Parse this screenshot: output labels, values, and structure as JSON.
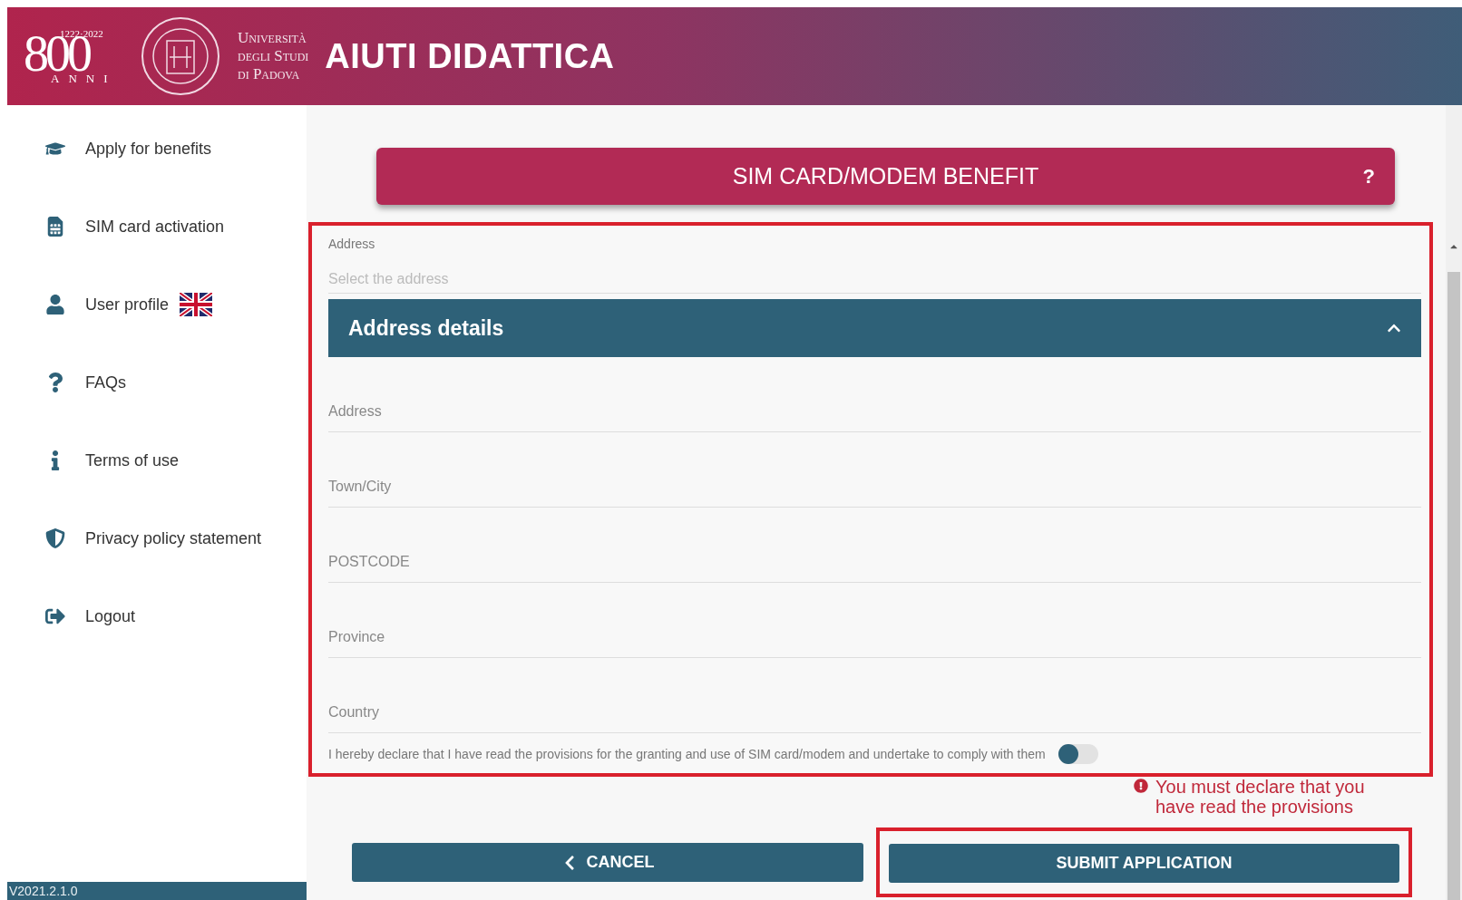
{
  "header": {
    "logo_years": "1222·2022",
    "logo_number": "800",
    "logo_word": "ANNI",
    "university_lines": [
      "Università",
      "degli Studi",
      "di Padova"
    ],
    "title": "AIUTI DIDATTICA"
  },
  "sidebar": {
    "items": [
      {
        "label": "Apply for benefits",
        "flag": false
      },
      {
        "label": "SIM card activation",
        "flag": false
      },
      {
        "label": "User profile",
        "flag": true
      },
      {
        "label": "FAQs",
        "flag": false
      },
      {
        "label": "Terms of use",
        "flag": false
      },
      {
        "label": "Privacy policy statement",
        "flag": false
      },
      {
        "label": "Logout",
        "flag": false
      }
    ],
    "version": "V2021.2.1.0"
  },
  "title_bar": {
    "title": "SIM CARD/MODEM BENEFIT",
    "help": "?"
  },
  "form": {
    "address_select": {
      "label": "Address",
      "placeholder": "Select the address"
    },
    "accordion": {
      "title": "Address details",
      "expanded": true
    },
    "fields": [
      {
        "placeholder": "Address"
      },
      {
        "placeholder": "Town/City"
      },
      {
        "placeholder": "POSTCODE"
      },
      {
        "placeholder": "Province"
      },
      {
        "placeholder": "Country"
      }
    ],
    "declaration": {
      "text": "I hereby declare that I have read the provisions for the granting and use of SIM card/modem and undertake to comply with them",
      "on": false
    },
    "error": "You must declare that you have read the provisions"
  },
  "buttons": {
    "cancel": "CANCEL",
    "submit": "SUBMIT APPLICATION"
  }
}
